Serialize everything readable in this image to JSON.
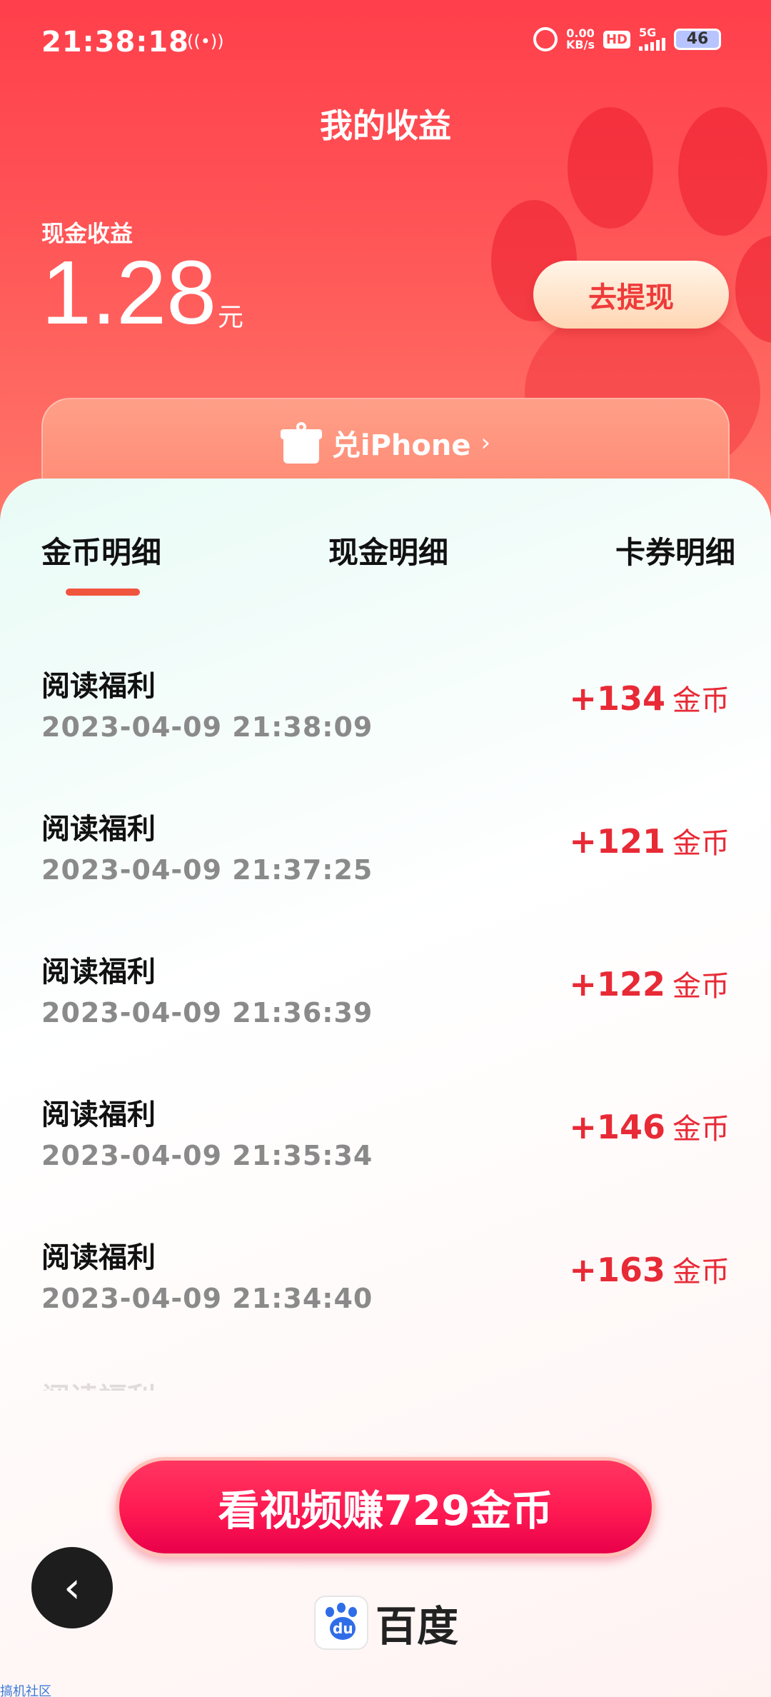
{
  "status_bar": {
    "time": "21:38:18",
    "net_speed_value": "0.00",
    "net_speed_unit": "KB/s",
    "hd_badge": "HD",
    "network": "5G",
    "battery": "46"
  },
  "header": {
    "title": "我的收益",
    "cash_label": "现金收益",
    "cash_value": "1.28",
    "cash_unit": "元",
    "withdraw_label": "去提现",
    "redeem_label": "兑iPhone",
    "redeem_chevron": "›"
  },
  "tabs": [
    {
      "label": "金币明细",
      "active": true
    },
    {
      "label": "现金明细",
      "active": false
    },
    {
      "label": "卡券明细",
      "active": false
    }
  ],
  "records": [
    {
      "title": "阅读福利",
      "time": "2023-04-09 21:38:09",
      "amount": "+134",
      "unit": "金币"
    },
    {
      "title": "阅读福利",
      "time": "2023-04-09 21:37:25",
      "amount": "+121",
      "unit": "金币"
    },
    {
      "title": "阅读福利",
      "time": "2023-04-09 21:36:39",
      "amount": "+122",
      "unit": "金币"
    },
    {
      "title": "阅读福利",
      "time": "2023-04-09 21:35:34",
      "amount": "+146",
      "unit": "金币"
    },
    {
      "title": "阅读福利",
      "time": "2023-04-09 21:34:40",
      "amount": "+163",
      "unit": "金币"
    }
  ],
  "partial_record_title": "阅读福利",
  "cta": {
    "label": "看视频赚729金币"
  },
  "back_icon": "‹",
  "brand": {
    "name": "百度",
    "logo_text": "du"
  },
  "watermark": "搞机社区",
  "colors": {
    "accent": "#ff4a50",
    "amount": "#e82a36",
    "tab_indicator": "#f0553d"
  }
}
